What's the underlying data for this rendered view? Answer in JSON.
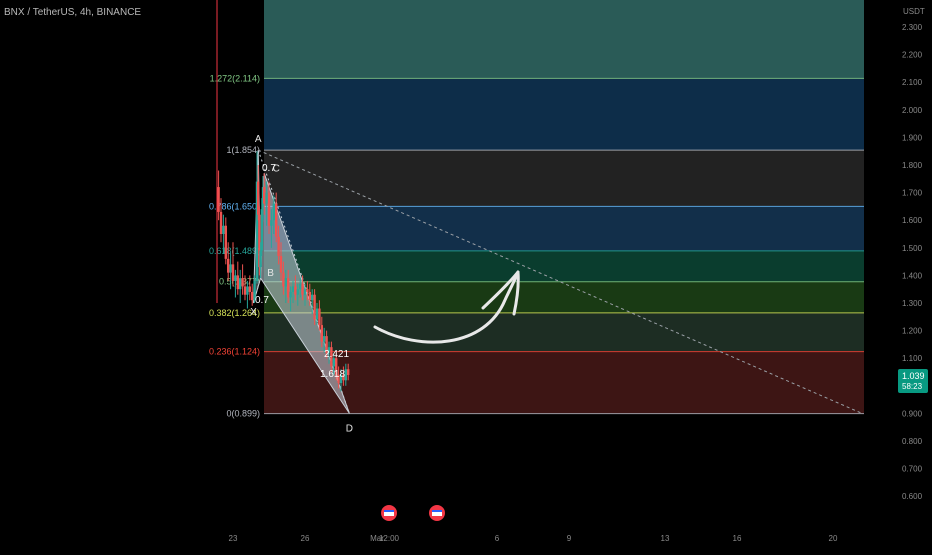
{
  "header": {
    "symbol": "BNX / TetherUS, 4h, BINANCE"
  },
  "chart_data": {
    "type": "candlestick",
    "y_axis": {
      "unit": "USDT",
      "range": [
        0.58,
        2.36
      ],
      "ticks": [
        "2.300",
        "2.200",
        "2.100",
        "2.000",
        "1.900",
        "1.800",
        "1.700",
        "1.600",
        "1.500",
        "1.400",
        "1.300",
        "1.200",
        "1.100",
        "1.000",
        "0.900",
        "0.800",
        "0.700",
        "0.600"
      ]
    },
    "x_axis": {
      "ticks": [
        {
          "label": "23",
          "d": 0
        },
        {
          "label": "26",
          "d": 3
        },
        {
          "label": "Mar",
          "d": 6
        },
        {
          "label": "12:00",
          "d": 6.5
        },
        {
          "label": "6",
          "d": 11
        },
        {
          "label": "9",
          "d": 14
        },
        {
          "label": "13",
          "d": 18
        },
        {
          "label": "16",
          "d": 21
        },
        {
          "label": "20",
          "d": 25
        }
      ]
    },
    "current_price": {
      "value": 1.039,
      "price_label": "1.039",
      "countdown": "58:23",
      "color": "#089981"
    },
    "fib_levels": [
      {
        "ratio": "1.272",
        "value": 2.114,
        "label": "1.272(2.114)",
        "label_color": "#81c784",
        "fill": "#2a5b57"
      },
      {
        "ratio": "1",
        "value": 1.854,
        "label": "1(1.854)",
        "label_color": "#b2b5be",
        "fill": "#0d2d49"
      },
      {
        "ratio": "0.786",
        "value": 1.65,
        "label": "0.786(1.650)",
        "label_color": "#64b5f6",
        "fill": "#222222"
      },
      {
        "ratio": "0.618",
        "value": 1.489,
        "label": "0.618(1.489)",
        "label_color": "#26a69a",
        "fill": "#122f4a"
      },
      {
        "ratio": "0.5",
        "value": 1.377,
        "label": "0.5(1.377)",
        "label_color": "#81c784",
        "fill": "#0a3d2e"
      },
      {
        "ratio": "0.382",
        "value": 1.264,
        "label": "0.382(1.264)",
        "label_color": "#d4e157",
        "fill": "#193a14"
      },
      {
        "ratio": "0.236",
        "value": 1.124,
        "label": "0.236(1.124)",
        "label_color": "#f44336",
        "fill": "#1d2d23"
      },
      {
        "ratio": "0",
        "value": 0.899,
        "label": "0(0.899)",
        "label_color": "#b2b5be",
        "fill": "#3d1514"
      }
    ],
    "harmonic": {
      "points": [
        {
          "name": "X",
          "d": 0.85,
          "v": 1.3
        },
        {
          "name": "A",
          "d": 1.05,
          "v": 1.854
        },
        {
          "name": "B",
          "d": 1.15,
          "v": 1.39
        },
        {
          "name": "C",
          "d": 1.3,
          "v": 1.77
        },
        {
          "name": "D",
          "d": 4.85,
          "v": 0.9
        }
      ],
      "ratio_labels": [
        "0.7",
        "0.7",
        "2.421",
        "1.618"
      ]
    },
    "candles": [
      {
        "d": -0.6,
        "o": 1.72,
        "h": 1.78,
        "l": 1.6,
        "c": 1.63
      },
      {
        "d": -0.5,
        "o": 1.63,
        "h": 1.68,
        "l": 1.52,
        "c": 1.55
      },
      {
        "d": -0.4,
        "o": 1.55,
        "h": 1.62,
        "l": 1.48,
        "c": 1.58
      },
      {
        "d": -0.3,
        "o": 1.58,
        "h": 1.61,
        "l": 1.44,
        "c": 1.46
      },
      {
        "d": -0.2,
        "o": 1.46,
        "h": 1.52,
        "l": 1.38,
        "c": 1.41
      },
      {
        "d": -0.1,
        "o": 1.41,
        "h": 1.48,
        "l": 1.35,
        "c": 1.44
      },
      {
        "d": 0.0,
        "o": 1.44,
        "h": 1.52,
        "l": 1.36,
        "c": 1.38
      },
      {
        "d": 0.1,
        "o": 1.38,
        "h": 1.42,
        "l": 1.32,
        "c": 1.4
      },
      {
        "d": 0.2,
        "o": 1.4,
        "h": 1.45,
        "l": 1.33,
        "c": 1.35
      },
      {
        "d": 0.3,
        "o": 1.35,
        "h": 1.42,
        "l": 1.3,
        "c": 1.39
      },
      {
        "d": 0.4,
        "o": 1.39,
        "h": 1.44,
        "l": 1.33,
        "c": 1.36
      },
      {
        "d": 0.5,
        "o": 1.36,
        "h": 1.4,
        "l": 1.31,
        "c": 1.33
      },
      {
        "d": 0.6,
        "o": 1.33,
        "h": 1.38,
        "l": 1.28,
        "c": 1.36
      },
      {
        "d": 0.7,
        "o": 1.36,
        "h": 1.4,
        "l": 1.31,
        "c": 1.34
      },
      {
        "d": 0.8,
        "o": 1.34,
        "h": 1.37,
        "l": 1.29,
        "c": 1.31
      },
      {
        "d": 0.9,
        "o": 1.31,
        "h": 1.4,
        "l": 1.3,
        "c": 1.38
      },
      {
        "d": 1.0,
        "o": 1.38,
        "h": 1.85,
        "l": 1.37,
        "c": 1.74
      },
      {
        "d": 1.05,
        "o": 1.74,
        "h": 1.8,
        "l": 1.6,
        "c": 1.62
      },
      {
        "d": 1.1,
        "o": 1.62,
        "h": 1.65,
        "l": 1.4,
        "c": 1.43
      },
      {
        "d": 1.15,
        "o": 1.43,
        "h": 1.52,
        "l": 1.39,
        "c": 1.49
      },
      {
        "d": 1.2,
        "o": 1.49,
        "h": 1.68,
        "l": 1.47,
        "c": 1.64
      },
      {
        "d": 1.25,
        "o": 1.64,
        "h": 1.76,
        "l": 1.6,
        "c": 1.72
      },
      {
        "d": 1.3,
        "o": 1.72,
        "h": 1.77,
        "l": 1.62,
        "c": 1.66
      },
      {
        "d": 1.4,
        "o": 1.66,
        "h": 1.74,
        "l": 1.58,
        "c": 1.7
      },
      {
        "d": 1.5,
        "o": 1.7,
        "h": 1.74,
        "l": 1.55,
        "c": 1.58
      },
      {
        "d": 1.6,
        "o": 1.58,
        "h": 1.64,
        "l": 1.5,
        "c": 1.6
      },
      {
        "d": 1.7,
        "o": 1.6,
        "h": 1.69,
        "l": 1.55,
        "c": 1.66
      },
      {
        "d": 1.8,
        "o": 1.66,
        "h": 1.7,
        "l": 1.52,
        "c": 1.54
      },
      {
        "d": 1.9,
        "o": 1.54,
        "h": 1.58,
        "l": 1.44,
        "c": 1.47
      },
      {
        "d": 2.0,
        "o": 1.47,
        "h": 1.52,
        "l": 1.38,
        "c": 1.41
      },
      {
        "d": 2.1,
        "o": 1.41,
        "h": 1.45,
        "l": 1.33,
        "c": 1.36
      },
      {
        "d": 2.2,
        "o": 1.36,
        "h": 1.42,
        "l": 1.3,
        "c": 1.39
      },
      {
        "d": 2.3,
        "o": 1.39,
        "h": 1.42,
        "l": 1.3,
        "c": 1.32
      },
      {
        "d": 2.4,
        "o": 1.32,
        "h": 1.36,
        "l": 1.27,
        "c": 1.34
      },
      {
        "d": 2.5,
        "o": 1.34,
        "h": 1.38,
        "l": 1.3,
        "c": 1.36
      },
      {
        "d": 2.6,
        "o": 1.36,
        "h": 1.4,
        "l": 1.31,
        "c": 1.33
      },
      {
        "d": 2.7,
        "o": 1.33,
        "h": 1.37,
        "l": 1.29,
        "c": 1.35
      },
      {
        "d": 2.8,
        "o": 1.35,
        "h": 1.39,
        "l": 1.32,
        "c": 1.37
      },
      {
        "d": 2.9,
        "o": 1.37,
        "h": 1.4,
        "l": 1.31,
        "c": 1.33
      },
      {
        "d": 3.0,
        "o": 1.33,
        "h": 1.37,
        "l": 1.29,
        "c": 1.35
      },
      {
        "d": 3.1,
        "o": 1.35,
        "h": 1.38,
        "l": 1.31,
        "c": 1.34
      },
      {
        "d": 3.2,
        "o": 1.34,
        "h": 1.37,
        "l": 1.29,
        "c": 1.31
      },
      {
        "d": 3.3,
        "o": 1.31,
        "h": 1.35,
        "l": 1.26,
        "c": 1.33
      },
      {
        "d": 3.4,
        "o": 1.33,
        "h": 1.35,
        "l": 1.22,
        "c": 1.24
      },
      {
        "d": 3.5,
        "o": 1.24,
        "h": 1.3,
        "l": 1.22,
        "c": 1.28
      },
      {
        "d": 3.6,
        "o": 1.28,
        "h": 1.31,
        "l": 1.2,
        "c": 1.22
      },
      {
        "d": 3.7,
        "o": 1.22,
        "h": 1.25,
        "l": 1.14,
        "c": 1.16
      },
      {
        "d": 3.8,
        "o": 1.16,
        "h": 1.21,
        "l": 1.12,
        "c": 1.18
      },
      {
        "d": 3.9,
        "o": 1.18,
        "h": 1.2,
        "l": 1.1,
        "c": 1.12
      },
      {
        "d": 4.0,
        "o": 1.12,
        "h": 1.16,
        "l": 1.08,
        "c": 1.14
      },
      {
        "d": 4.1,
        "o": 1.14,
        "h": 1.16,
        "l": 1.05,
        "c": 1.07
      },
      {
        "d": 4.2,
        "o": 1.07,
        "h": 1.12,
        "l": 1.04,
        "c": 1.1
      },
      {
        "d": 4.3,
        "o": 1.1,
        "h": 1.12,
        "l": 1.02,
        "c": 1.04
      },
      {
        "d": 4.4,
        "o": 1.04,
        "h": 1.07,
        "l": 0.99,
        "c": 1.01
      },
      {
        "d": 4.5,
        "o": 1.01,
        "h": 1.06,
        "l": 0.98,
        "c": 1.04
      },
      {
        "d": 4.6,
        "o": 1.04,
        "h": 1.07,
        "l": 1.0,
        "c": 1.02
      },
      {
        "d": 4.7,
        "o": 1.02,
        "h": 1.08,
        "l": 1.0,
        "c": 1.06
      },
      {
        "d": 4.8,
        "o": 1.06,
        "h": 1.08,
        "l": 1.02,
        "c": 1.039
      }
    ]
  }
}
